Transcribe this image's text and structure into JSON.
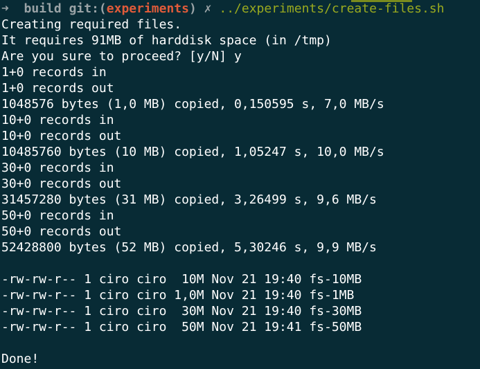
{
  "prompt": {
    "arrow": "➜",
    "dir": "build",
    "git_label": "git:",
    "paren_open": "(",
    "branch": "experiments",
    "paren_close": ")",
    "dirty_mark": "✗",
    "command": "../experiments/create-files.sh"
  },
  "output_lines": [
    "Creating required files.",
    "It requires 91MB of harddisk space (in /tmp)",
    "Are you sure to proceed? [y/N] y",
    "1+0 records in",
    "1+0 records out",
    "1048576 bytes (1,0 MB) copied, 0,150595 s, 7,0 MB/s",
    "10+0 records in",
    "10+0 records out",
    "10485760 bytes (10 MB) copied, 1,05247 s, 10,0 MB/s",
    "30+0 records in",
    "30+0 records out",
    "31457280 bytes (31 MB) copied, 3,26499 s, 9,6 MB/s",
    "50+0 records in",
    "50+0 records out",
    "52428800 bytes (52 MB) copied, 5,30246 s, 9,9 MB/s",
    "",
    "-rw-rw-r-- 1 ciro ciro  10M Nov 21 19:40 fs-10MB",
    "-rw-rw-r-- 1 ciro ciro 1,0M Nov 21 19:40 fs-1MB",
    "-rw-rw-r-- 1 ciro ciro  30M Nov 21 19:40 fs-30MB",
    "-rw-rw-r-- 1 ciro ciro  50M Nov 21 19:41 fs-50MB",
    "",
    "Done!"
  ],
  "colors": {
    "background": "#082b35",
    "text": "#ffffff",
    "prompt_gray": "#9aa3a6",
    "branch": "#e05b3a",
    "command": "#9aaa1f",
    "accent_bar": "#7a8b1e"
  }
}
